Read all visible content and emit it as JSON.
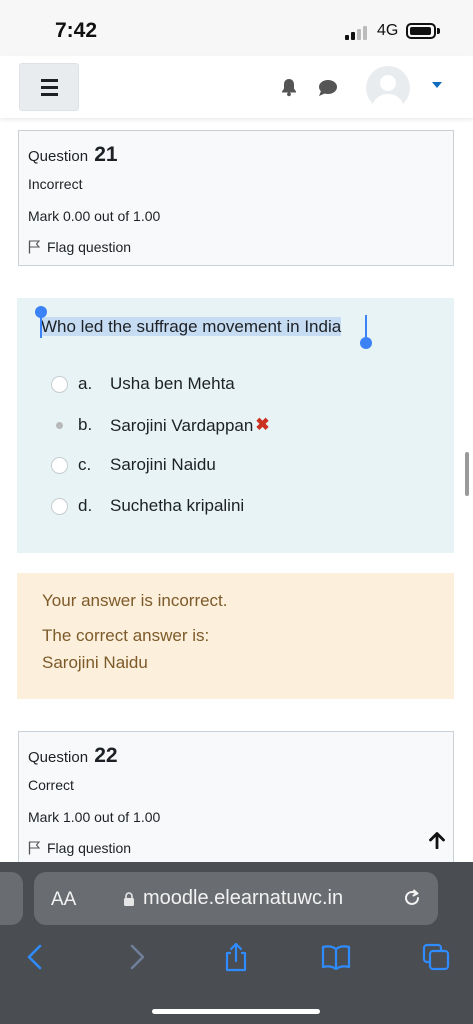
{
  "status_bar": {
    "time": "7:42",
    "network": "4G"
  },
  "questions": [
    {
      "label": "Question",
      "number": "21",
      "state": "Incorrect",
      "mark": "Mark 0.00 out of 1.00",
      "flag": "Flag question",
      "text": "Who led the suffrage movement in India",
      "answers": [
        {
          "letter": "a.",
          "text": "Usha ben Mehta",
          "selected": false
        },
        {
          "letter": "b.",
          "text": "Sarojini Vardappan",
          "selected": true,
          "incorrect_mark": "✖"
        },
        {
          "letter": "c.",
          "text": "Sarojini Naidu",
          "selected": false
        },
        {
          "letter": "d.",
          "text": "Suchetha kripalini",
          "selected": false
        }
      ],
      "feedback": {
        "result": "Your answer is incorrect.",
        "correct_label": "The correct answer is:",
        "correct_answer": "Sarojini Naidu"
      }
    },
    {
      "label": "Question",
      "number": "22",
      "state": "Correct",
      "mark": "Mark 1.00 out of 1.00",
      "flag": "Flag question"
    }
  ],
  "browser": {
    "aa_label": "AA",
    "url": "moodle.elearnatuwc.in"
  },
  "colors": {
    "accent": "#0f6cbf",
    "incorrect": "#ca3120",
    "feedback_bg": "#fcefdc",
    "formulation_bg": "#e7f3f5",
    "safari_blue": "#2f8cff"
  }
}
